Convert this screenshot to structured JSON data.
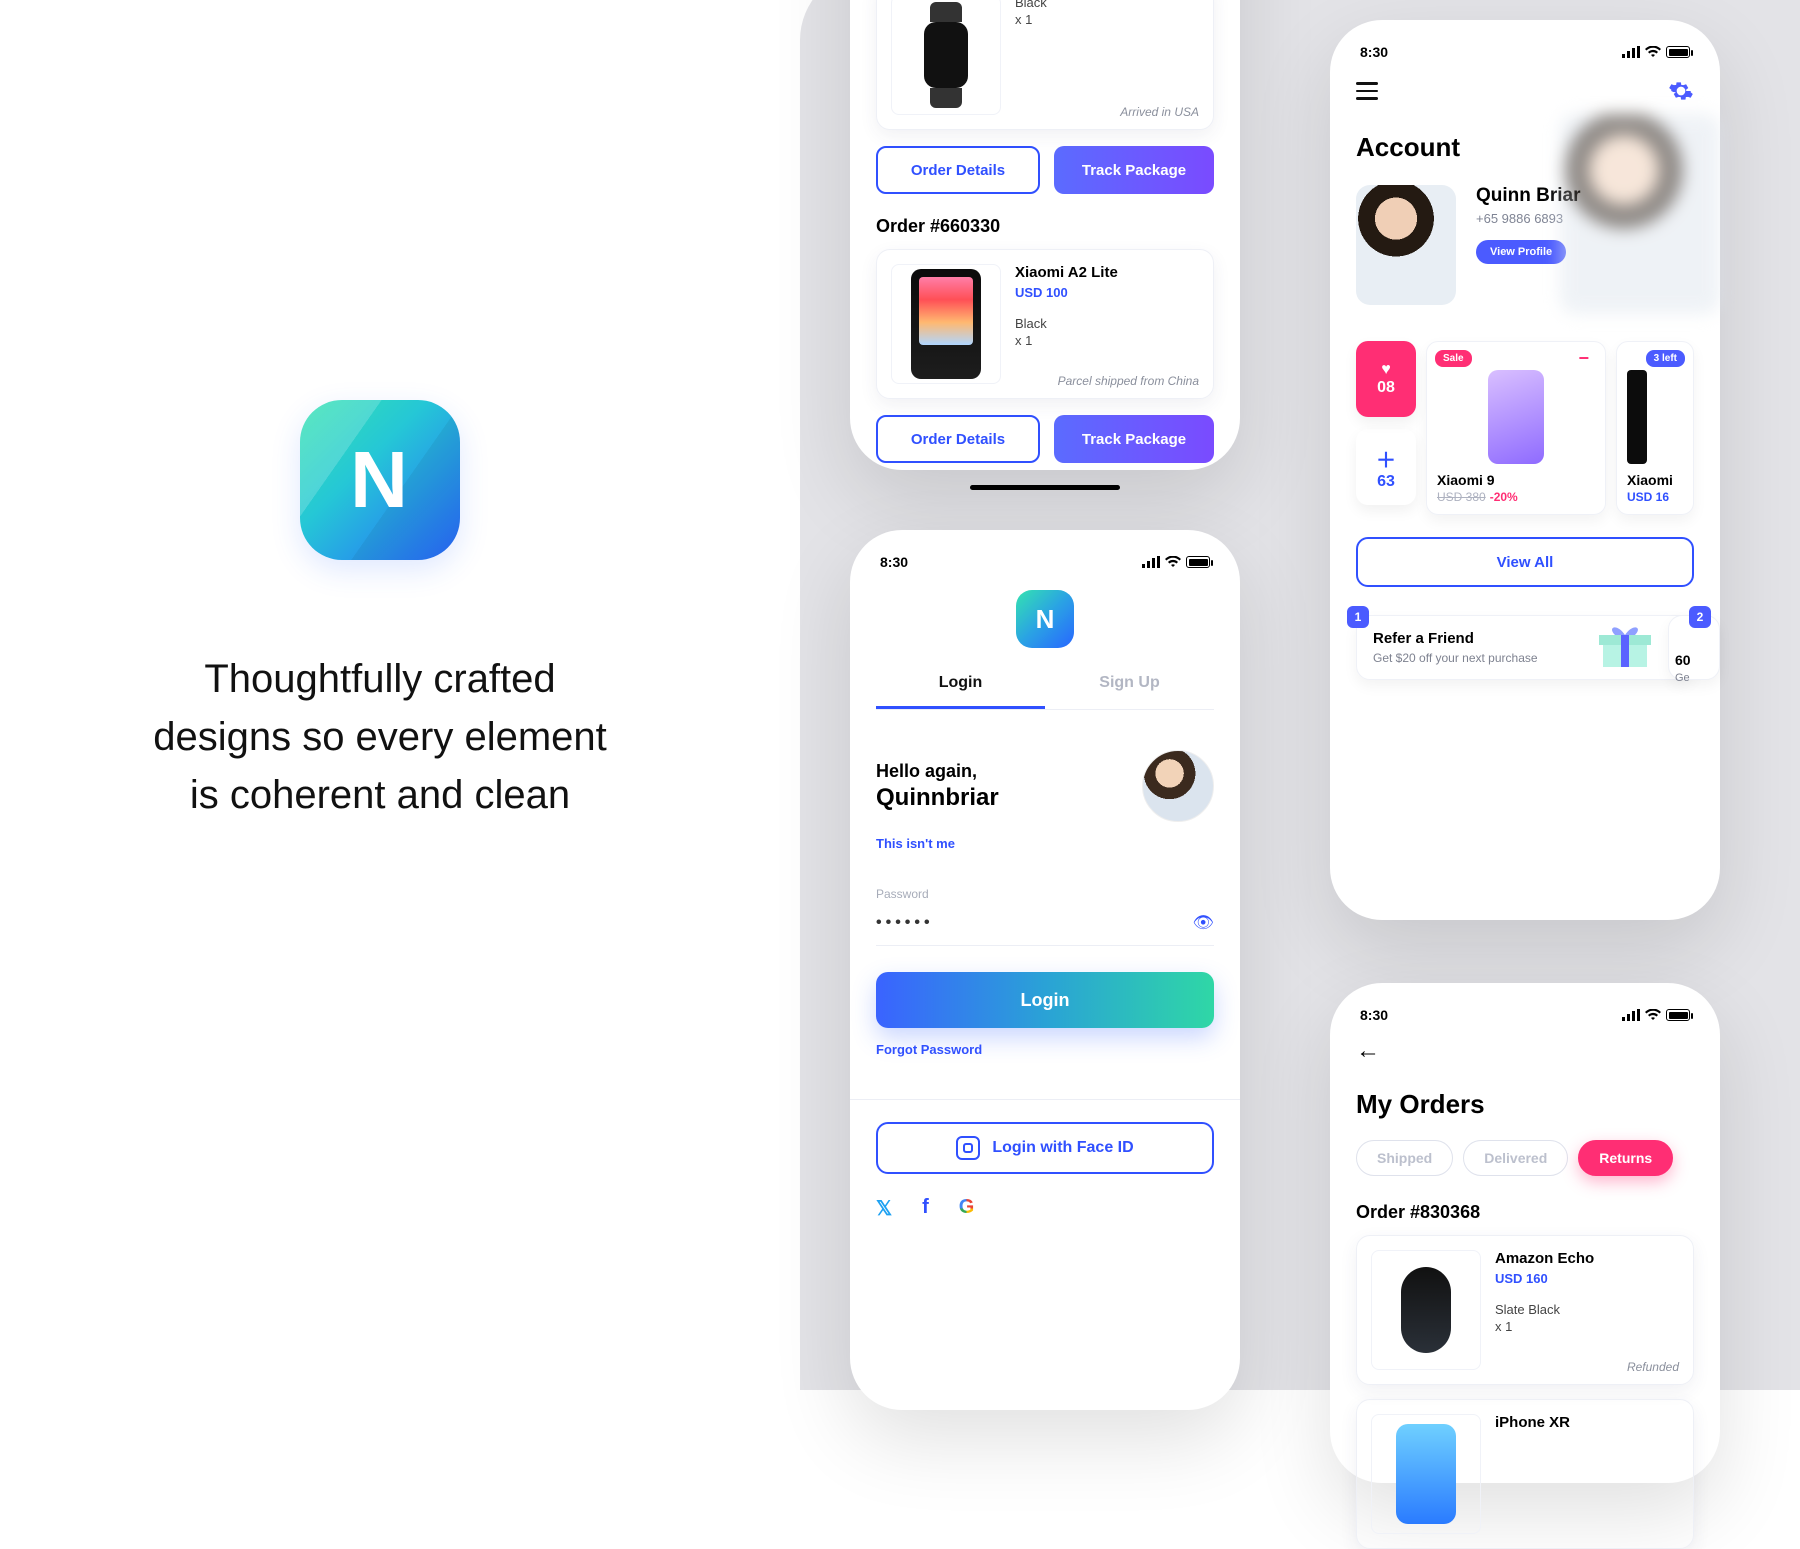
{
  "hero": {
    "logo_letter": "N",
    "text_line1": "Thoughtfully crafted",
    "text_line2": "designs so every element",
    "text_line3": "is coherent and clean"
  },
  "statusbar_time": "8:30",
  "statusbar_wifi": "wifi",
  "phone_a": {
    "order0": {
      "name": "Watch",
      "color": "Black",
      "qty": "x 1",
      "status": "Arrived in USA"
    },
    "btn_details": "Order Details",
    "btn_track": "Track Package",
    "order1_title": "Order #660330",
    "order1": {
      "name": "Xiaomi A2 Lite",
      "price": "USD 100",
      "color": "Black",
      "qty": "x 1",
      "status": "Parcel shipped from China"
    }
  },
  "phone_b": {
    "logo_letter": "N",
    "tab_login": "Login",
    "tab_signup": "Sign Up",
    "hello": "Hello again,",
    "username": "Quinnbriar",
    "not_me": "This isn't me",
    "password_label": "Password",
    "password_mask": "••••••",
    "btn_login": "Login",
    "forgot": "Forgot Password",
    "btn_faceid": "Login with Face ID",
    "social_twitter": "twitter",
    "social_facebook": "facebook",
    "social_google": "G"
  },
  "phone_c": {
    "title": "Account",
    "name": "Quinn Briar",
    "phone": "+65 9886 6893",
    "btn_profile": "View Profile",
    "heart_count": "08",
    "plus_count": "63",
    "p1_badge": "Sale",
    "p1_name": "Xiaomi 9",
    "p1_old": "USD 380",
    "p1_disc": "-20%",
    "p2_badge": "3 left",
    "p2_name": "Xiaomi",
    "p2_price": "USD 16",
    "btn_viewall": "View All",
    "promo1_num": "1",
    "promo1_title": "Refer a Friend",
    "promo1_sub": "Get $20 off your next purchase",
    "promo2_num": "2",
    "promo2_peek_title": "60",
    "promo2_peek_sub": "Ge"
  },
  "phone_d": {
    "title": "My Orders",
    "chip_shipped": "Shipped",
    "chip_delivered": "Delivered",
    "chip_returns": "Returns",
    "order_title": "Order #830368",
    "o1_name": "Amazon Echo",
    "o1_price": "USD 160",
    "o1_color": "Slate Black",
    "o1_qty": "x 1",
    "o1_status": "Refunded",
    "o2_name": "iPhone XR"
  }
}
